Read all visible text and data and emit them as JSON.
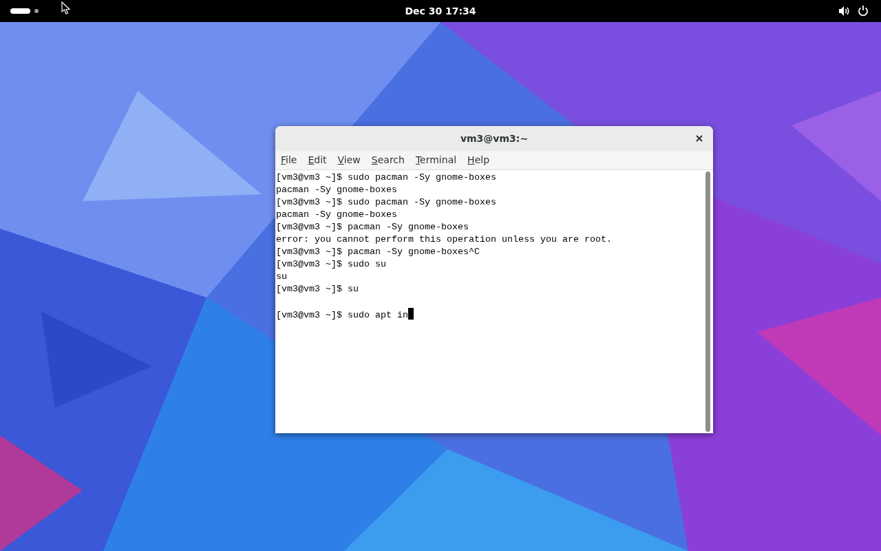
{
  "top_bar": {
    "clock": "Dec 30  17:34"
  },
  "window": {
    "title": "vm3@vm3:~",
    "menu": [
      {
        "label": "File"
      },
      {
        "label": "Edit"
      },
      {
        "label": "View"
      },
      {
        "label": "Search"
      },
      {
        "label": "Terminal"
      },
      {
        "label": "Help"
      }
    ],
    "terminal_lines": [
      {
        "kind": "text",
        "text": "[vm3@vm3 ~]$ sudo pacman -Sy gnome-boxes"
      },
      {
        "kind": "text",
        "text": "pacman -Sy gnome-boxes"
      },
      {
        "kind": "text",
        "text": "[vm3@vm3 ~]$ sudo pacman -Sy gnome-boxes"
      },
      {
        "kind": "text",
        "text": "pacman -Sy gnome-boxes"
      },
      {
        "kind": "text",
        "text": "[vm3@vm3 ~]$ pacman -Sy gnome-boxes"
      },
      {
        "kind": "text",
        "text": "error: you cannot perform this operation unless you are root."
      },
      {
        "kind": "text",
        "text": "[vm3@vm3 ~]$ pacman -Sy gnome-boxes^C"
      },
      {
        "kind": "text",
        "text": "[vm3@vm3 ~]$ sudo su"
      },
      {
        "kind": "text",
        "text": "su"
      },
      {
        "kind": "text",
        "text": "[vm3@vm3 ~]$ su"
      },
      {
        "kind": "blank"
      },
      {
        "kind": "prompt",
        "text": "[vm3@vm3 ~]$ sudo apt in"
      }
    ]
  }
}
